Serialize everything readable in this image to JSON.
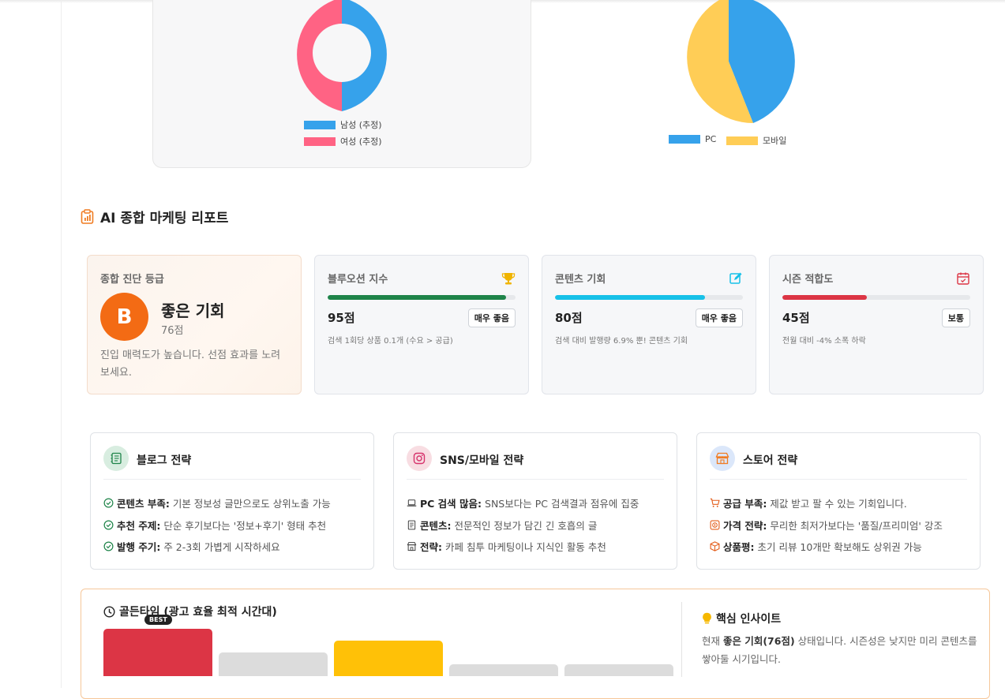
{
  "gender_chart": {
    "legend": [
      {
        "label": "남성 (추정)",
        "color": "#36a2eb"
      },
      {
        "label": "여성 (추정)",
        "color": "#ff6384"
      }
    ],
    "values": [
      50,
      50
    ]
  },
  "device_chart": {
    "legend": [
      {
        "label": "PC",
        "color": "#36a2eb"
      },
      {
        "label": "모바일",
        "color": "#ffcd56"
      }
    ],
    "values": [
      43,
      57
    ]
  },
  "report": {
    "title": "AI 종합 마케팅 리포트",
    "grade": {
      "label": "종합 진단 등급",
      "letter": "B",
      "name": "좋은 기회",
      "score": "76점",
      "description": "진입 매력도가 높습니다. 선점 효과를 노려보세요."
    },
    "metrics": [
      {
        "title": "블루오션 지수",
        "score": "95점",
        "tag": "매우 좋음",
        "desc": "검색 1회당 상품 0.1개 (수요 > 공급)",
        "fill": 0.95,
        "color": "#1e8449"
      },
      {
        "title": "콘텐츠 기회",
        "score": "80점",
        "tag": "매우 좋음",
        "desc": "검색 대비 발행량 6.9% 뿐! 콘텐츠 기회",
        "fill": 0.8,
        "color": "#17c1e8"
      },
      {
        "title": "시즌 적합도",
        "score": "45점",
        "tag": "보통",
        "desc": "전월 대비 -4% 소폭 하락",
        "fill": 0.45,
        "color": "#dc3545"
      }
    ]
  },
  "strategies": {
    "blog": {
      "title": "블로그 전략",
      "items": [
        {
          "bold": "콘텐츠 부족:",
          "text": " 기본 정보성 글만으로도 상위노출 가능"
        },
        {
          "bold": "추천 주제:",
          "text": " 단순 후기보다는 '정보+후기' 형태 추천"
        },
        {
          "bold": "발행 주기:",
          "text": " 주 2-3회 가볍게 시작하세요"
        }
      ]
    },
    "sns": {
      "title": "SNS/모바일 전략",
      "items": [
        {
          "bold": "PC 검색 많음:",
          "text": " SNS보다는 PC 검색결과 점유에 집중"
        },
        {
          "bold": "콘텐츠:",
          "text": " 전문적인 정보가 담긴 긴 호흡의 글"
        },
        {
          "bold": "전략:",
          "text": " 카페 침투 마케팅이나 지식인 활동 추천"
        }
      ]
    },
    "store": {
      "title": "스토어 전략",
      "items": [
        {
          "bold": "공급 부족:",
          "text": " 제값 받고 팔 수 있는 기회입니다."
        },
        {
          "bold": "가격 전략:",
          "text": " 무리한 최저가보다는 '품질/프리미엄' 강조"
        },
        {
          "bold": "상품평:",
          "text": " 초기 리뷰 10개만 확보해도 상위권 가능"
        }
      ]
    }
  },
  "golden_time": {
    "title": "골든타임 (광고 효율 최적 시간대)",
    "best_label": "BEST",
    "bars": [
      {
        "value": 1.0,
        "color": "#dc3545"
      },
      {
        "value": 0.5,
        "color": "#dcdcdc"
      },
      {
        "value": 0.75,
        "color": "#ffc107"
      },
      {
        "value": 0.25,
        "color": "#dcdcdc"
      },
      {
        "value": 0.25,
        "color": "#dcdcdc"
      }
    ]
  },
  "insight": {
    "title": "핵심 인사이트",
    "prefix": "현재 ",
    "highlight": "좋은 기회(76점)",
    "suffix": " 상태입니다. 시즌성은 낮지만 미리 콘텐츠를 쌓아둘 시기입니다."
  }
}
